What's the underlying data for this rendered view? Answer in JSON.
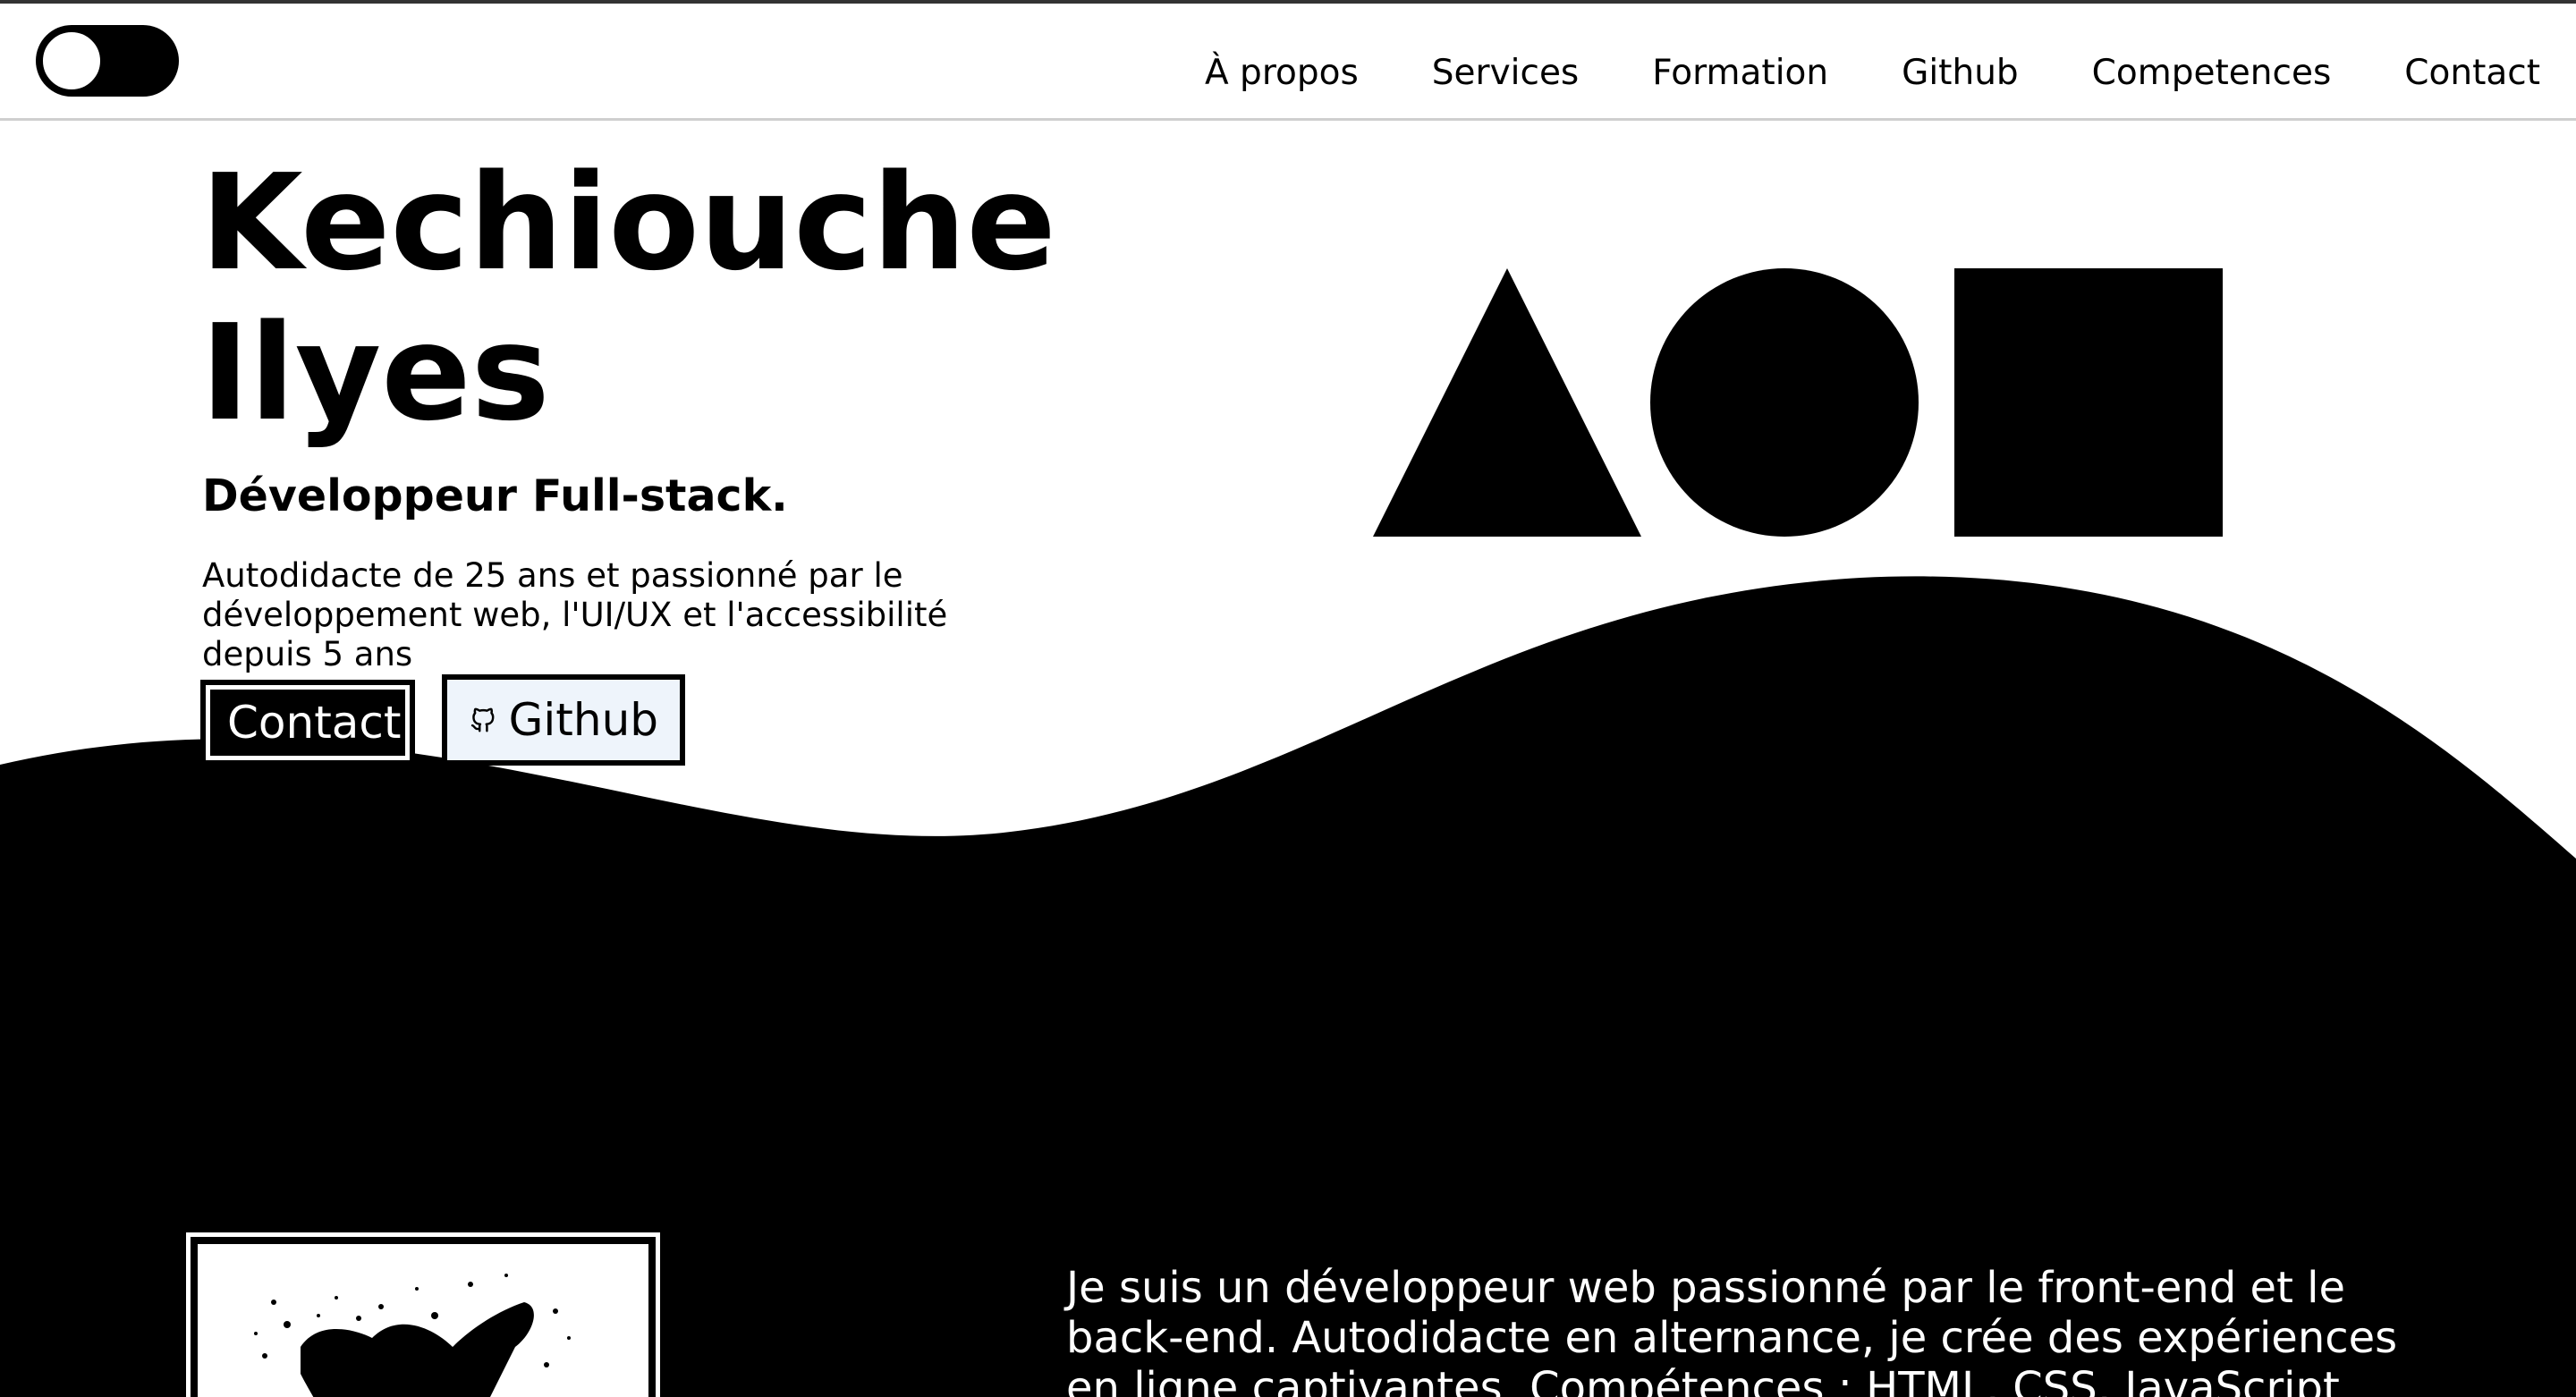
{
  "nav": {
    "theme_toggle": "theme-toggle",
    "links": [
      "À propos",
      "Services",
      "Formation",
      "Github",
      "Competences",
      "Contact"
    ]
  },
  "hero": {
    "title_line1": "Kechiouche",
    "title_line2": "Ilyes",
    "subtitle": "Développeur Full-stack.",
    "description": "Autodidacte de 25 ans et passionné par le développement web, l'UI/UX et l'accessibilité depuis 5 ans",
    "contact_button": "Contact",
    "github_button": "Github",
    "github_icon": "github-icon"
  },
  "about": {
    "text": "Je suis un développeur web passionné par le front-end et le back-end. Autodidacte en alternance, je crée des expériences en ligne captivantes. Compétences : HTML, CSS, JavaScript"
  },
  "colors": {
    "primary": "#000000",
    "background": "#ffffff",
    "github_button_bg": "#eef4fb"
  }
}
